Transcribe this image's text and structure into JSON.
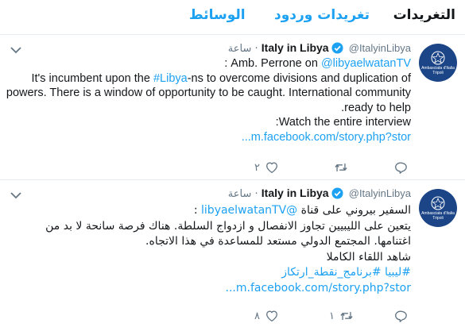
{
  "tabs": [
    {
      "label": "التغريدات",
      "active": true
    },
    {
      "label": "تغريدات وردود",
      "active": false
    },
    {
      "label": "الوسائط",
      "active": false
    }
  ],
  "colors": {
    "accent": "#1da1f2",
    "text": "#14171a",
    "muted": "#657786",
    "avatar_bg": "#1c4587"
  },
  "tweets": [
    {
      "name": "Italy in Libya",
      "handle": "@ItalyinLibya",
      "dot": "·",
      "time": "ساعة",
      "avatar_text": [
        "Ambasciata d'Italia",
        "Tripoli"
      ],
      "lines": [
        {
          "prefix": "Amb. Perrone on ",
          "mention": "@libyaelwatanTV",
          "suffix": " :"
        },
        {
          "prefix": "It's incumbent upon the ",
          "mention": "#Libya",
          "suffix": "-ns to overcome divisions and duplication of"
        },
        {
          "text": "powers. There is a window of opportunity to be caught. International community"
        },
        {
          "text": "ready to help."
        },
        {
          "text": "Watch the entire interview:"
        },
        {
          "link": "m.facebook.com/story.php?stor..."
        }
      ],
      "actions": {
        "replies": "",
        "retweets": "",
        "likes": "٢"
      }
    },
    {
      "name": "Italy in Libya",
      "handle": "@ItalyinLibya",
      "dot": "·",
      "time": "ساعة",
      "avatar_text": [
        "Ambasciata d'Italia",
        "Tripoli"
      ],
      "lines": [
        {
          "prefix": "السفير بيروني على قناة ",
          "mention": "@libyaelwatanTV",
          "suffix": " :"
        },
        {
          "text": "يتعين على الليبيين تجاوز الانفصال و ازدواج السلطة. هناك فرصة سانحة لا بد من"
        },
        {
          "text": "اغتنامها. المجتمع الدولي مستعد للمساعدة في هذا الاتجاه."
        },
        {
          "text": "شاهد اللقاء الكاملا"
        },
        {
          "link": "#ليبيا #برنامج_نقطة_ارتكاز"
        },
        {
          "link": "m.facebook.com/story.php?stor..."
        }
      ],
      "actions": {
        "replies": "",
        "retweets": "١",
        "likes": "٨"
      }
    }
  ]
}
